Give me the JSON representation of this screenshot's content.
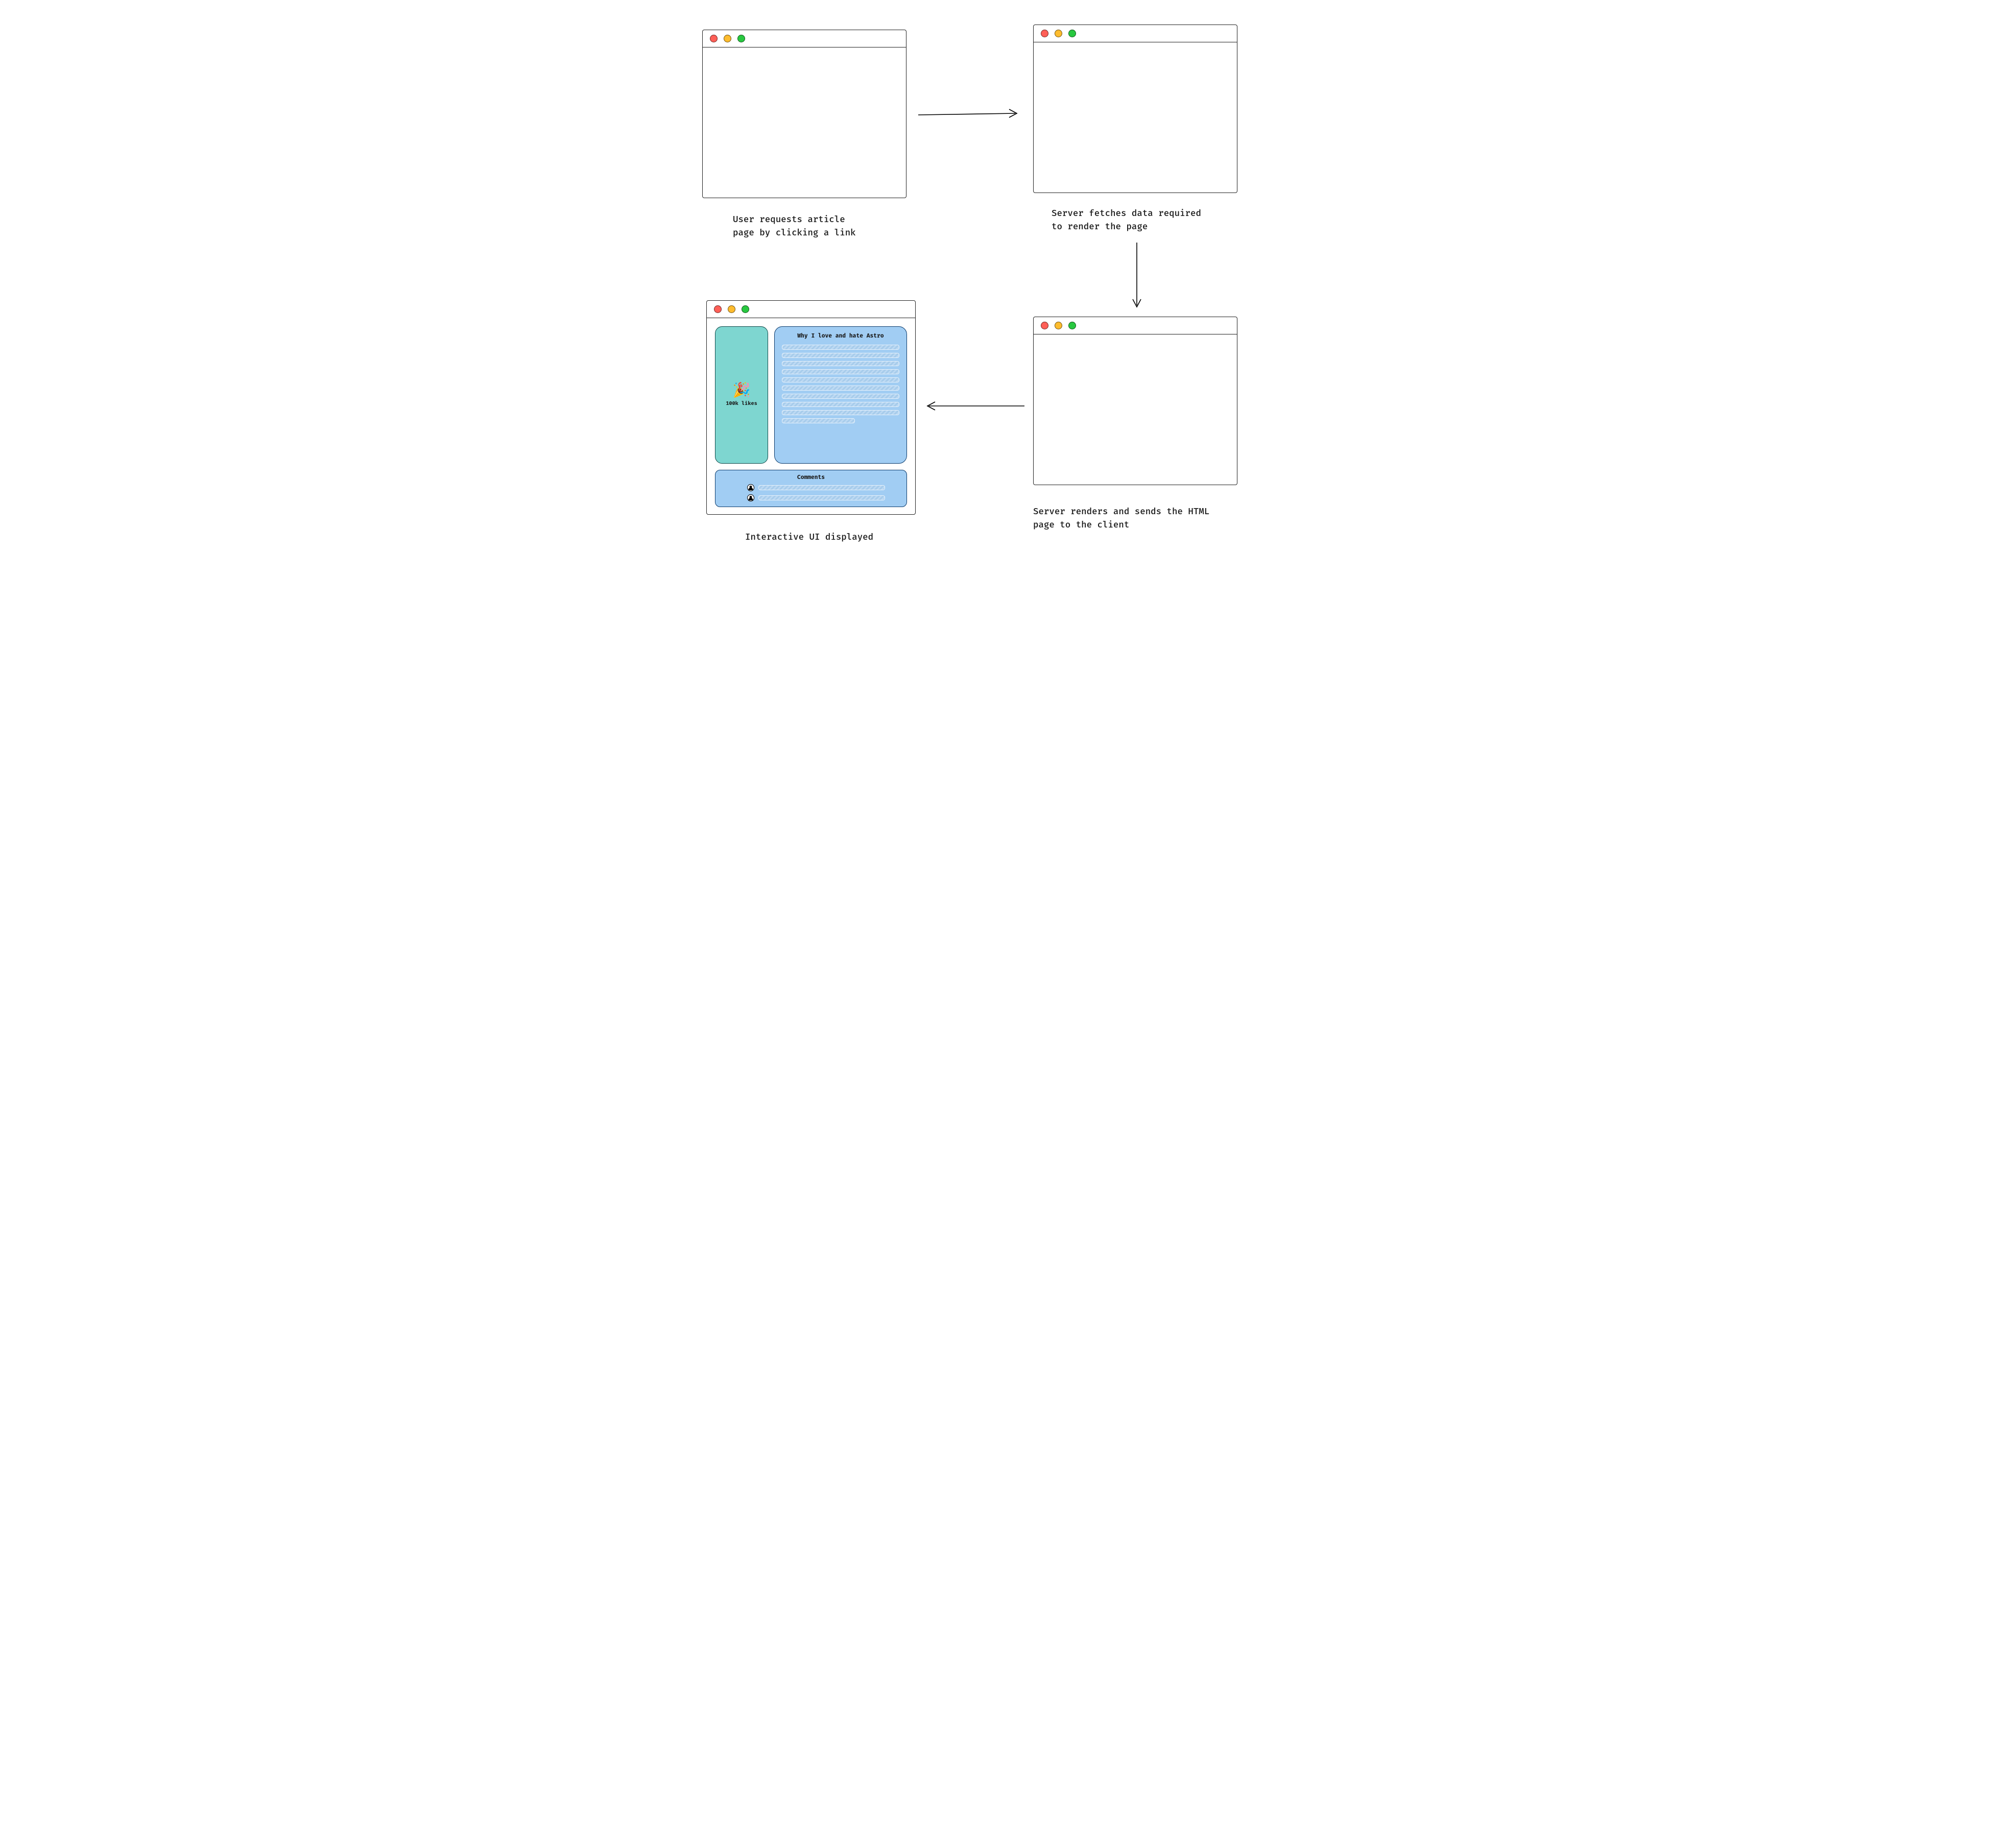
{
  "steps": {
    "step1": {
      "caption": "User requests article\npage by clicking a link"
    },
    "step2": {
      "caption": "Server fetches data required\nto render the page"
    },
    "step3": {
      "caption": "Server renders and sends the HTML\npage to the client"
    },
    "step4": {
      "caption": "Interactive UI displayed"
    }
  },
  "article": {
    "title": "Why I love and hate Astro",
    "likes_emoji": "🎉",
    "likes_label": "100k likes",
    "comments_heading": "Comments"
  },
  "traffic_lights": {
    "red": "#ff5f57",
    "yellow": "#febc2e",
    "green": "#28c840"
  }
}
